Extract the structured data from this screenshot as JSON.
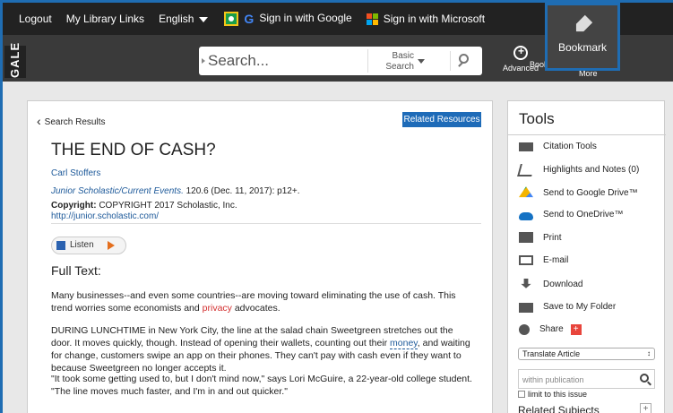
{
  "topbar": {
    "logout": "Logout",
    "library_links": "My Library Links",
    "language": "English",
    "google_signin": "Sign in with Google",
    "microsoft_signin": "Sign in with Microsoft"
  },
  "brand": "GALE",
  "search": {
    "placeholder": "Search...",
    "mode_line1": "Basic",
    "mode_line2": "Search"
  },
  "header_tools": {
    "advanced": "Advanced",
    "bookmark": "Bookmark",
    "more": "More",
    "popup_label": "Bookmark"
  },
  "article": {
    "back_link": "Search Results",
    "related_button": "Related Resources",
    "title": "THE END OF CASH?",
    "author": "Carl Stoffers",
    "source_pub": "Junior Scholastic/Current Events.",
    "source_rest": " 120.6 (Dec. 11, 2017): p12+.",
    "copyright_label": "Copyright:",
    "copyright_text": " COPYRIGHT 2017 Scholastic, Inc.",
    "copyright_url": "http://junior.scholastic.com/",
    "listen": "Listen",
    "fulltext_heading": "Full Text:",
    "p1_a": "Many businesses--and even some countries--are moving toward eliminating the use of cash. This trend worries some economists and ",
    "p1_link": "privacy",
    "p1_b": " advocates.",
    "p2_a": "DURING LUNCHTIME in New York City, the line at the salad chain Sweetgreen stretches out the door. It moves quickly, though. Instead of opening their wallets, counting out their ",
    "p2_link": "money",
    "p2_b": ", and waiting for change, customers swipe an app on their phones. They can't pay with cash even if they want to because Sweetgreen no longer accepts it.",
    "p3": "\"It took some getting used to, but I don't mind now,\" says Lori McGuire, a 22-year-old college student. \"The line moves much faster, and I'm in and out quicker.\""
  },
  "tools": {
    "heading": "Tools",
    "items": [
      {
        "label": "Citation Tools",
        "icon": "citation-icon"
      },
      {
        "label": "Highlights and Notes (0)",
        "icon": "highlight-icon"
      },
      {
        "label": "Send to Google Drive™",
        "icon": "google-drive-icon"
      },
      {
        "label": "Send to OneDrive™",
        "icon": "onedrive-icon"
      },
      {
        "label": "Print",
        "icon": "print-icon"
      },
      {
        "label": "E-mail",
        "icon": "email-icon"
      },
      {
        "label": "Download",
        "icon": "download-icon"
      },
      {
        "label": "Save to My Folder",
        "icon": "folder-icon"
      },
      {
        "label": "Share",
        "icon": "share-icon"
      }
    ],
    "translate_select": "Translate Article",
    "within_placeholder": "within publication",
    "limit_label": "limit to this issue",
    "related_subjects": "Related Subjects",
    "plus": "+"
  },
  "colors": {
    "accent_blue": "#1e6bb8",
    "frame_blue": "#1f6db3",
    "link_red": "#d32f2f",
    "topbar": "#222222"
  }
}
